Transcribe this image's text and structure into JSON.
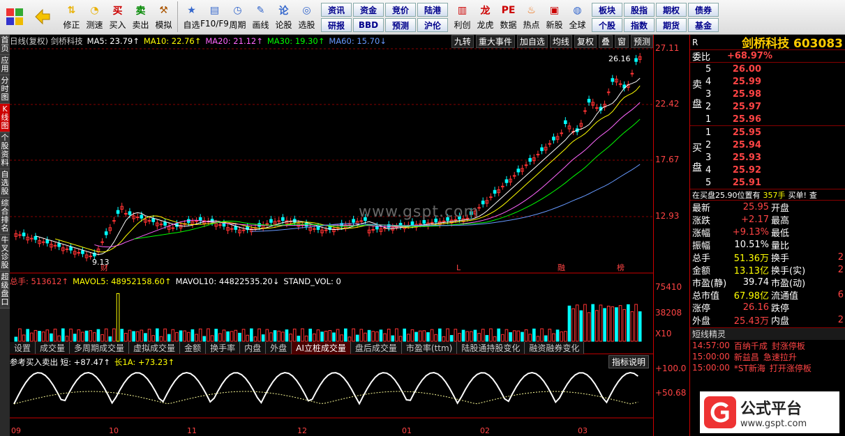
{
  "toolbar": {
    "buttons": [
      {
        "label": "修正",
        "icon": "arrow-up-down-icon"
      },
      {
        "label": "测速",
        "icon": "speed-icon"
      },
      {
        "label": "买入",
        "icon": "buy-icon",
        "glyph": "买"
      },
      {
        "label": "卖出",
        "icon": "sell-icon",
        "glyph": "卖"
      },
      {
        "label": "模拟",
        "icon": "hammer-icon"
      }
    ],
    "buttons2": [
      {
        "label": "自选",
        "icon": "star-icon"
      },
      {
        "label": "F10/F9",
        "icon": "f10-icon"
      },
      {
        "label": "周期",
        "icon": "clock-icon"
      },
      {
        "label": "画线",
        "icon": "pen-icon"
      },
      {
        "label": "论股",
        "icon": "discuss-icon"
      },
      {
        "label": "选股",
        "icon": "select-icon"
      }
    ],
    "grid_buttons": [
      "资讯",
      "资金",
      "竞价",
      "陆港",
      "研报",
      "BBD",
      "预测",
      "沪伦"
    ],
    "buttons3": [
      {
        "label": "利创",
        "icon": "chart-icon"
      },
      {
        "label": "龙虎",
        "icon": "dragon-icon"
      },
      {
        "label": "数据",
        "icon": "pe-icon",
        "glyph": "PE"
      },
      {
        "label": "热点",
        "icon": "hot-icon"
      },
      {
        "label": "新股",
        "icon": "ipo-icon"
      },
      {
        "label": "全球",
        "icon": "globe-icon"
      }
    ],
    "grid_buttons2": [
      "板块",
      "股指",
      "期权",
      "债券",
      "个股",
      "指数",
      "期货",
      "基金"
    ]
  },
  "sidetabs": [
    "首页",
    "应用",
    "分时图",
    "K线图",
    "个股资料",
    "自选股",
    "综合排名",
    "牛叉诊股",
    "超级盘口"
  ],
  "chart": {
    "header": "日线(复权) 剑桥科技",
    "ma": [
      {
        "label": "MA5: 23.79↑",
        "color": "#ffffff"
      },
      {
        "label": "MA10: 22.76↑",
        "color": "#ffff00"
      },
      {
        "label": "MA20: 21.12↑",
        "color": "#ff66ff"
      },
      {
        "label": "MA30: 19.30↑",
        "color": "#00ff00"
      },
      {
        "label": "MA60: 15.70↓",
        "color": "#6699ff"
      }
    ],
    "panel_buttons": [
      "九转",
      "重大事件",
      "加自选",
      "均线",
      "复权",
      "叠",
      "窗",
      "预测"
    ],
    "price_labels": [
      "27.11",
      "22.42",
      "17.67",
      "12.93"
    ],
    "high_label": "26.16",
    "low_label": "9.13",
    "markers": [
      "财",
      "L",
      "融",
      "榜"
    ],
    "watermark": "www.gspt.com",
    "volume_header": [
      {
        "label": "总手: 513612↑",
        "color": "#ff4444"
      },
      {
        "label": "MAVOL5: 48952158.60↑",
        "color": "#ffff00"
      },
      {
        "label": "MAVOL10: 44822535.20↓",
        "color": "#ffffff"
      },
      {
        "label": "STAND_VOL: 0",
        "color": "#ffffff"
      }
    ],
    "volume_labels": [
      "75410",
      "38208",
      "X10"
    ],
    "bottom_tabs": [
      "设置",
      "成交量",
      "多周期成交量",
      "虚拟成交量",
      "金额",
      "换手率",
      "内盘",
      "外盘",
      "AI立桩成交量",
      "盘后成交量",
      "市盈率(ttm)",
      "陆股通持股变化",
      "融资融券变化"
    ],
    "indicator_header": [
      {
        "label": "参考买入卖出 短: +87.47↑",
        "color": "#ffffff"
      },
      {
        "label": "长1A: +73.23↑",
        "color": "#ffff00"
      }
    ],
    "indicator_button": "指标说明",
    "indicator_labels": [
      "+100.0",
      "+50.68"
    ],
    "months": [
      "09",
      "10",
      "11",
      "12",
      "01",
      "02",
      "03"
    ]
  },
  "quote": {
    "r_label": "R",
    "name": "剑桥科技",
    "code": "603083",
    "weibi_label": "委比",
    "weibi_value": "+68.97%",
    "sell_label": "卖盘",
    "buy_label": "买盘",
    "sells": [
      {
        "lvl": "5",
        "price": "26.00"
      },
      {
        "lvl": "4",
        "price": "25.99"
      },
      {
        "lvl": "3",
        "price": "25.98"
      },
      {
        "lvl": "2",
        "price": "25.97"
      },
      {
        "lvl": "1",
        "price": "25.96"
      }
    ],
    "buys": [
      {
        "lvl": "1",
        "price": "25.95"
      },
      {
        "lvl": "2",
        "price": "25.94"
      },
      {
        "lvl": "3",
        "price": "25.93"
      },
      {
        "lvl": "4",
        "price": "25.92"
      },
      {
        "lvl": "5",
        "price": "25.91"
      }
    ],
    "trade_line": {
      "a": "在买盘25.90位置有",
      "b": "357手",
      "c": "买单!",
      "d": "查"
    },
    "stats": [
      {
        "l": "最新",
        "v": "25.95",
        "vc": "red",
        "l2": "开盘",
        "v2": ""
      },
      {
        "l": "涨跌",
        "v": "+2.17",
        "vc": "red",
        "l2": "最高",
        "v2": ""
      },
      {
        "l": "涨幅",
        "v": "+9.13%",
        "vc": "red",
        "l2": "最低",
        "v2": ""
      },
      {
        "l": "振幅",
        "v": "10.51%",
        "vc": "white",
        "l2": "量比",
        "v2": ""
      },
      {
        "l": "总手",
        "v": "51.36万",
        "vc": "yellow",
        "l2": "换手",
        "v2": "2"
      },
      {
        "l": "金额",
        "v": "13.13亿",
        "vc": "yellow",
        "l2": "换手(实)",
        "v2": "2"
      },
      {
        "l": "市盈(静)",
        "v": "39.74",
        "vc": "white",
        "l2": "市盈(动)",
        "v2": ""
      },
      {
        "l": "总市值",
        "v": "67.98亿",
        "vc": "yellow",
        "l2": "流通值",
        "v2": "6"
      },
      {
        "l": "涨停",
        "v": "26.16",
        "vc": "red",
        "l2": "跌停",
        "v2": ""
      },
      {
        "l": "外盘",
        "v": "25.43万",
        "vc": "red",
        "l2": "内盘",
        "v2": "2"
      }
    ],
    "news_title": "短线精灵",
    "news": [
      {
        "time": "14:57:00",
        "name": "百纳千成",
        "evt": "封涨停板"
      },
      {
        "time": "15:00:00",
        "name": "新益昌",
        "evt": "急速拉升"
      },
      {
        "time": "15:00:00",
        "name": "*ST新海",
        "evt": "打开涨停板"
      }
    ],
    "logo_text": "公式平台",
    "logo_url": "www.gspt.com"
  }
}
